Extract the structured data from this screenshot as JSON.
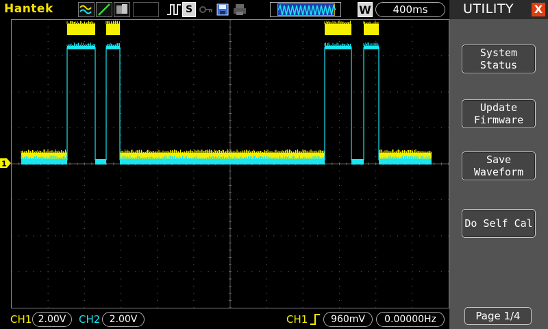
{
  "brand": "Hantek",
  "toolbar": {
    "icons": [
      "waveform-mode-icon",
      "line-mode-icon",
      "persist-mode-icon",
      "run-stop-icon",
      "single-icon",
      "key-icon",
      "save-icon",
      "print-icon"
    ],
    "single_label": "S",
    "window_label": "W",
    "timebase": "400ms"
  },
  "menu": {
    "title": "UTILITY",
    "close_label": "X",
    "buttons": [
      "System\nStatus",
      "Update\nFirmware",
      "Save\nWaveform",
      "Do Self Cal"
    ],
    "page_label": "Page 1/4"
  },
  "channels": {
    "ch1_label": "CH1",
    "ch1_scale": "2.00V",
    "ch2_label": "CH2",
    "ch2_scale": "2.00V",
    "ch1_color": "#f5f000",
    "ch2_color": "#19e6f0"
  },
  "trigger": {
    "source": "CH1",
    "level": "960mV",
    "frequency": "0.00000Hz"
  },
  "marker": {
    "ch1": "1"
  }
}
